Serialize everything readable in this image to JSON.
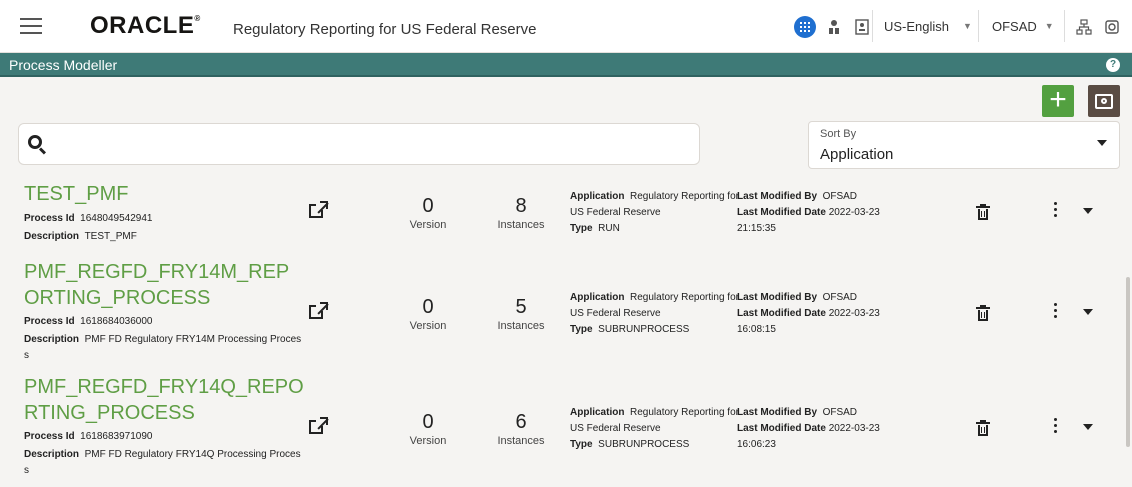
{
  "header": {
    "logo": "ORACLE",
    "app_title": "Regulatory Reporting for US Federal Reserve",
    "language": "US-English",
    "user": "OFSAD"
  },
  "module": {
    "title": "Process Modeller",
    "help": "?"
  },
  "toolbar": {
    "add_label": "+"
  },
  "search": {
    "value": "",
    "placeholder": ""
  },
  "sort": {
    "label": "Sort By",
    "value": "Application"
  },
  "processes": [
    {
      "name": "TEST_PMF",
      "process_id_label": "Process Id",
      "process_id": "1648049542941",
      "description_label": "Description",
      "description": "TEST_PMF",
      "version": "0",
      "version_label": "Version",
      "instances": "8",
      "instances_label": "Instances",
      "application_label": "Application",
      "application_1": "Regulatory Reporting for",
      "application_2": "US Federal Reserve",
      "type_label": "Type",
      "type": "RUN",
      "modified_by_label": "Last Modified By",
      "modified_by": "OFSAD",
      "modified_date_label": "Last Modified Date",
      "modified_date": "2022-03-23",
      "modified_time": "21:15:35"
    },
    {
      "name": "PMF_REGFD_FRY14M_REPORTING_PROCESS",
      "process_id_label": "Process Id",
      "process_id": "1618684036000",
      "description_label": "Description",
      "description": "PMF FD Regulatory FRY14M Processing Process",
      "version": "0",
      "version_label": "Version",
      "instances": "5",
      "instances_label": "Instances",
      "application_label": "Application",
      "application_1": "Regulatory Reporting for",
      "application_2": "US Federal Reserve",
      "type_label": "Type",
      "type": "SUBRUNPROCESS",
      "modified_by_label": "Last Modified By",
      "modified_by": "OFSAD",
      "modified_date_label": "Last Modified Date",
      "modified_date": "2022-03-23",
      "modified_time": "16:08:15"
    },
    {
      "name": "PMF_REGFD_FRY14Q_REPORTING_PROCESS",
      "process_id_label": "Process Id",
      "process_id": "1618683971090",
      "description_label": "Description",
      "description": "PMF FD Regulatory FRY14Q Processing Process",
      "version": "0",
      "version_label": "Version",
      "instances": "6",
      "instances_label": "Instances",
      "application_label": "Application",
      "application_1": "Regulatory Reporting for",
      "application_2": "US Federal Reserve",
      "type_label": "Type",
      "type": "SUBRUNPROCESS",
      "modified_by_label": "Last Modified By",
      "modified_by": "OFSAD",
      "modified_date_label": "Last Modified Date",
      "modified_date": "2022-03-23",
      "modified_time": "16:06:23"
    }
  ],
  "colors": {
    "process_name": "#5f9e45",
    "module_bar": "#3e7a77",
    "add_button": "#53a040",
    "apps_button": "#1f6fd0"
  },
  "icons": [
    "menu-icon",
    "apps-grid-icon",
    "user-org-icon",
    "contact-card-icon",
    "network-icon",
    "settings-icon",
    "help-icon",
    "add-icon",
    "screen-icon",
    "search-icon",
    "open-external-icon",
    "delete-icon",
    "kebab-icon",
    "chevron-down-icon"
  ]
}
